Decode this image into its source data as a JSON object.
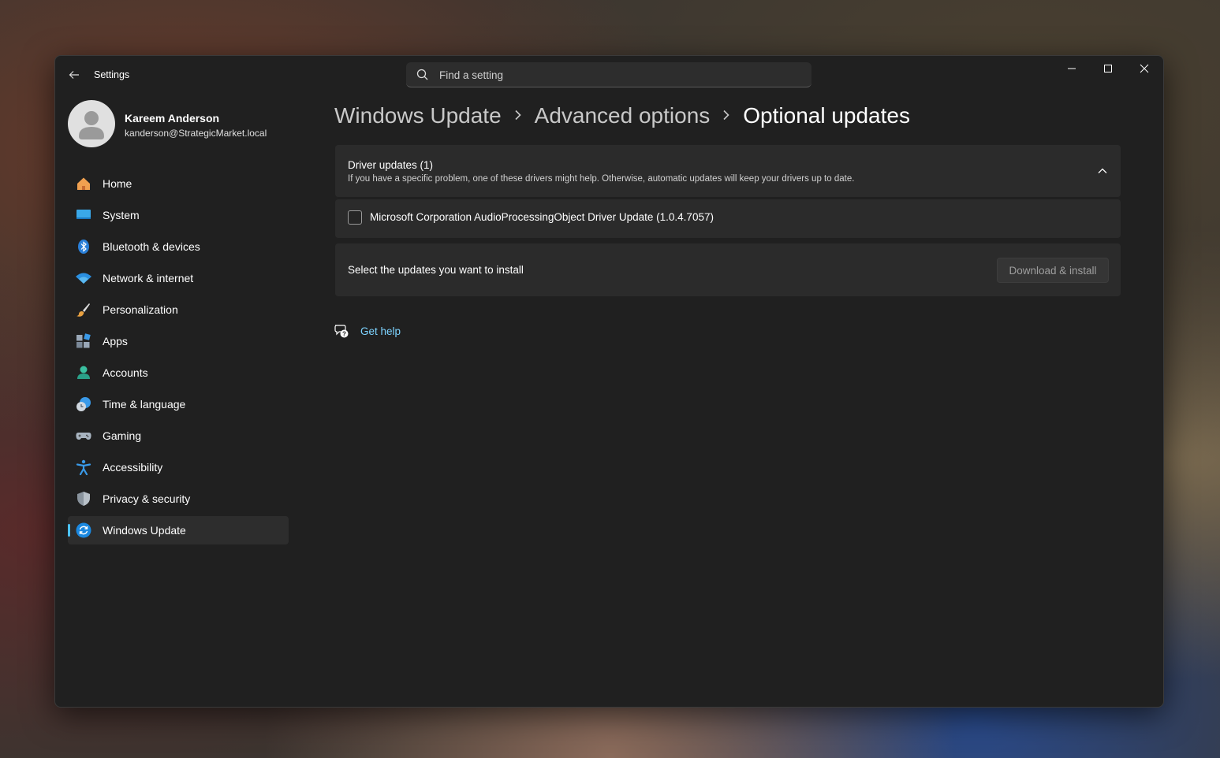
{
  "window": {
    "app_title": "Settings",
    "search_placeholder": "Find a setting"
  },
  "profile": {
    "name": "Kareem Anderson",
    "email": "kanderson@StrategicMarket.local"
  },
  "sidebar": {
    "items": [
      {
        "label": "Home",
        "icon": "home-icon"
      },
      {
        "label": "System",
        "icon": "system-icon"
      },
      {
        "label": "Bluetooth & devices",
        "icon": "bluetooth-icon"
      },
      {
        "label": "Network & internet",
        "icon": "wifi-icon"
      },
      {
        "label": "Personalization",
        "icon": "brush-icon"
      },
      {
        "label": "Apps",
        "icon": "apps-icon"
      },
      {
        "label": "Accounts",
        "icon": "accounts-icon"
      },
      {
        "label": "Time & language",
        "icon": "clock-globe-icon"
      },
      {
        "label": "Gaming",
        "icon": "gamepad-icon"
      },
      {
        "label": "Accessibility",
        "icon": "accessibility-icon"
      },
      {
        "label": "Privacy & security",
        "icon": "shield-icon"
      },
      {
        "label": "Windows Update",
        "icon": "update-icon",
        "active": true
      }
    ]
  },
  "breadcrumb": {
    "items": [
      "Windows Update",
      "Advanced options"
    ],
    "current": "Optional updates"
  },
  "driver_updates": {
    "title": "Driver updates (1)",
    "description": "If you have a specific problem, one of these drivers might help. Otherwise, automatic updates will keep your drivers up to date.",
    "items": [
      {
        "label": "Microsoft Corporation AudioProcessingObject Driver Update (1.0.4.7057)",
        "checked": false
      }
    ]
  },
  "install": {
    "label": "Select the updates you want to install",
    "button_label": "Download & install",
    "button_enabled": false
  },
  "help": {
    "label": "Get help"
  },
  "colors": {
    "accent": "#4cc2ff",
    "link": "#7dd3ff",
    "window_bg": "#202020",
    "card_bg": "#2b2b2b"
  }
}
